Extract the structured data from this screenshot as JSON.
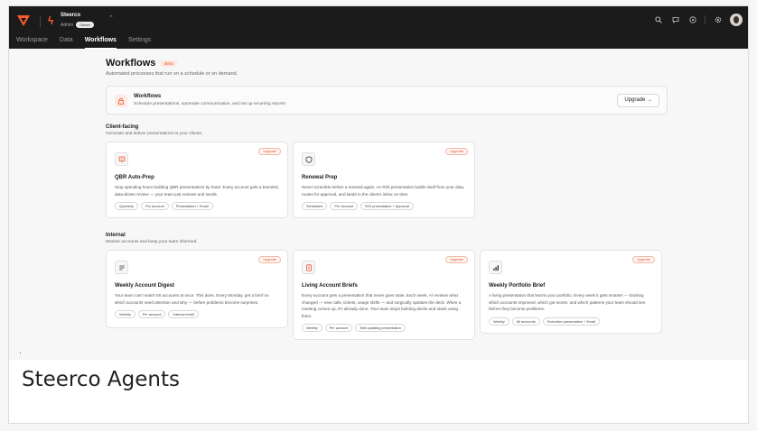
{
  "org": {
    "name": "Steerco",
    "role_label": "Admin",
    "role_badge": "Owner"
  },
  "nav": [
    {
      "label": "Workspace",
      "active": false
    },
    {
      "label": "Data",
      "active": false
    },
    {
      "label": "Workflows",
      "active": true
    },
    {
      "label": "Settings",
      "active": false
    }
  ],
  "page": {
    "title": "Workflows",
    "badge": "Beta",
    "subtitle": "Automated processes that run on a schedule or on demand."
  },
  "banner": {
    "title": "Workflows",
    "description": "Schedule presentations, automate communication, and set up recurring reports",
    "button": "Upgrade →"
  },
  "sections": [
    {
      "title": "Client-facing",
      "subtitle": "Generate and deliver presentations to your clients.",
      "cards": [
        {
          "upgrade": "Upgrade",
          "title": "QBR Auto-Prep",
          "description": "Stop spending hours building QBR presentations by hand. Every account gets a branded, data-driven review — your team just reviews and sends.",
          "tags": [
            "Quarterly",
            "Per account",
            "Presentation + Email"
          ]
        },
        {
          "upgrade": "Upgrade",
          "title": "Renewal Prep",
          "description": "Never scramble before a renewal again. An ROI presentation builds itself from your data, routes for approval, and lands in the client's inbox on time.",
          "tags": [
            "Scheduled",
            "Per account",
            "ROI presentation + Approval"
          ]
        }
      ]
    },
    {
      "title": "Internal",
      "subtitle": "Monitor accounts and keep your team informed.",
      "cards": [
        {
          "upgrade": "Upgrade",
          "title": "Weekly Account Digest",
          "description": "Your team can't watch 50 accounts at once. This does. Every Monday, get a brief on which accounts need attention and why — before problems become surprises.",
          "tags": [
            "Weekly",
            "Per account",
            "Internal email"
          ]
        },
        {
          "upgrade": "Upgrade",
          "title": "Living Account Briefs",
          "description": "Every account gets a presentation that never goes stale. Each week, AI reviews what changed — new calls, tickets, usage shifts — and surgically updates the deck. When a meeting comes up, it's already done. Your team stops building decks and starts using them.",
          "tags": [
            "Weekly",
            "Per account",
            "Self-updating presentation"
          ]
        },
        {
          "upgrade": "Upgrade",
          "title": "Weekly Portfolio Brief",
          "description": "A living presentation that learns your portfolio. Every week it gets smarter — tracking which accounts improved, which got worse, and which patterns your team should see before they become problems.",
          "tags": [
            "Weekly",
            "All accounts",
            "Executive presentation + Email"
          ]
        }
      ]
    }
  ],
  "caption": "Steerco Agents",
  "colors": {
    "accent": "#e8542b",
    "topbar": "#1b1b1b",
    "background": "#f7f7f7"
  }
}
